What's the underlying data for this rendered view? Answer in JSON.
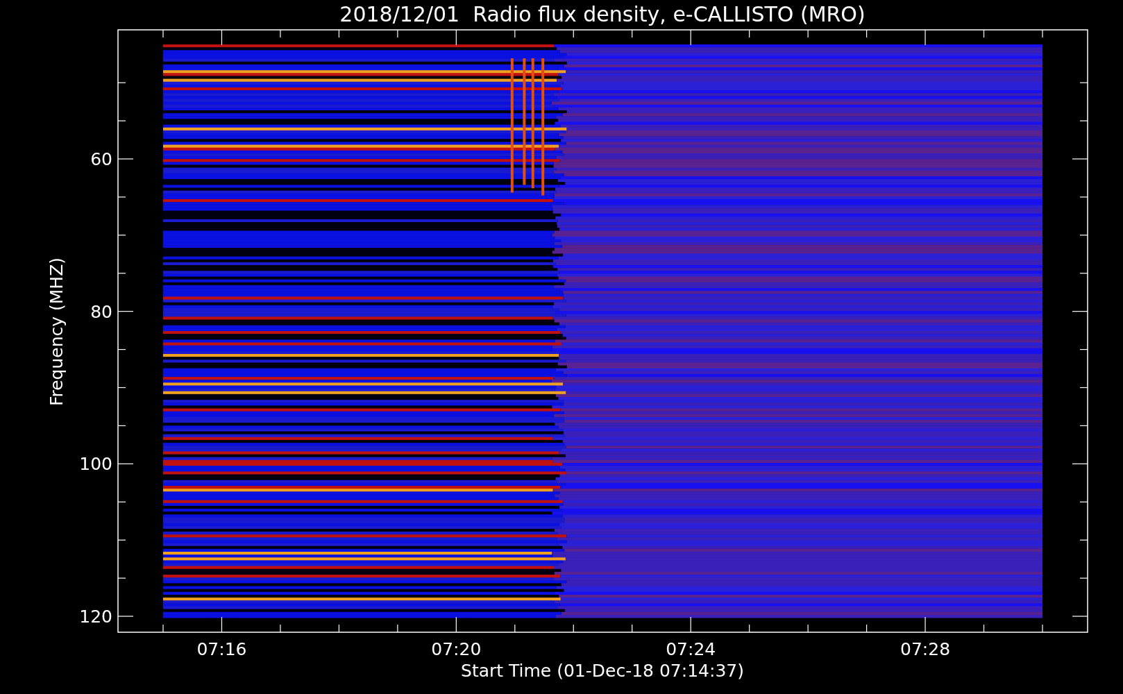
{
  "title": "2018/12/01  Radio flux density, e-CALLISTO (MRO)",
  "y_axis": {
    "label": "Frequency (MHZ)",
    "ticks": [
      "60",
      "80",
      "100",
      "120"
    ]
  },
  "x_axis": {
    "label": "Start Time (01-Dec-18 07:14:37)",
    "ticks": [
      "07:16",
      "07:20",
      "07:24",
      "07:28"
    ]
  }
}
